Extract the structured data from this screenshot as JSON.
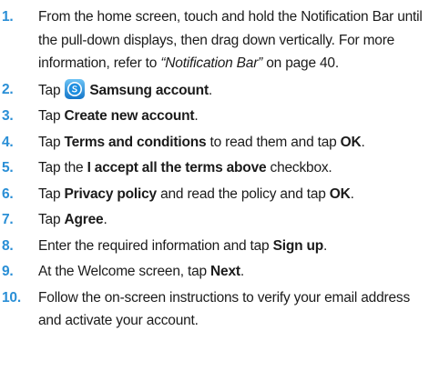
{
  "steps": [
    {
      "num": "1.",
      "p1": "From the home screen, touch and hold the Notification Bar until the pull-down displays, then drag down vertically. For more information, refer to ",
      "ref": "“Notification Bar”",
      "p2": " on page 40."
    },
    {
      "num": "2.",
      "p1": "Tap",
      "icon": "samsung-account-app-icon",
      "b1": "Samsung account",
      "p2": "."
    },
    {
      "num": "3.",
      "p1": "Tap ",
      "b1": "Create new account",
      "p2": "."
    },
    {
      "num": "4.",
      "p1": "Tap ",
      "b1": "Terms and conditions",
      "p2": " to read them and tap ",
      "b2": "OK",
      "p3": "."
    },
    {
      "num": "5.",
      "p1": "Tap the ",
      "b1": "I accept all the terms above",
      "p2": " checkbox."
    },
    {
      "num": "6.",
      "p1": "Tap ",
      "b1": "Privacy policy",
      "p2": " and read the policy and tap ",
      "b2": "OK",
      "p3": "."
    },
    {
      "num": "7.",
      "p1": "Tap ",
      "b1": "Agree",
      "p2": "."
    },
    {
      "num": "8.",
      "p1": "Enter the required information and tap ",
      "b1": "Sign up",
      "p2": "."
    },
    {
      "num": "9.",
      "p1": "At the Welcome screen, tap ",
      "b1": "Next",
      "p2": "."
    },
    {
      "num": "10.",
      "p1": "Follow the on-screen instructions to verify your email address and activate your account."
    }
  ],
  "colors": {
    "step_number": "#2a8fd6",
    "text": "#1b1b1b",
    "icon_blue": "#1e8fe0"
  }
}
